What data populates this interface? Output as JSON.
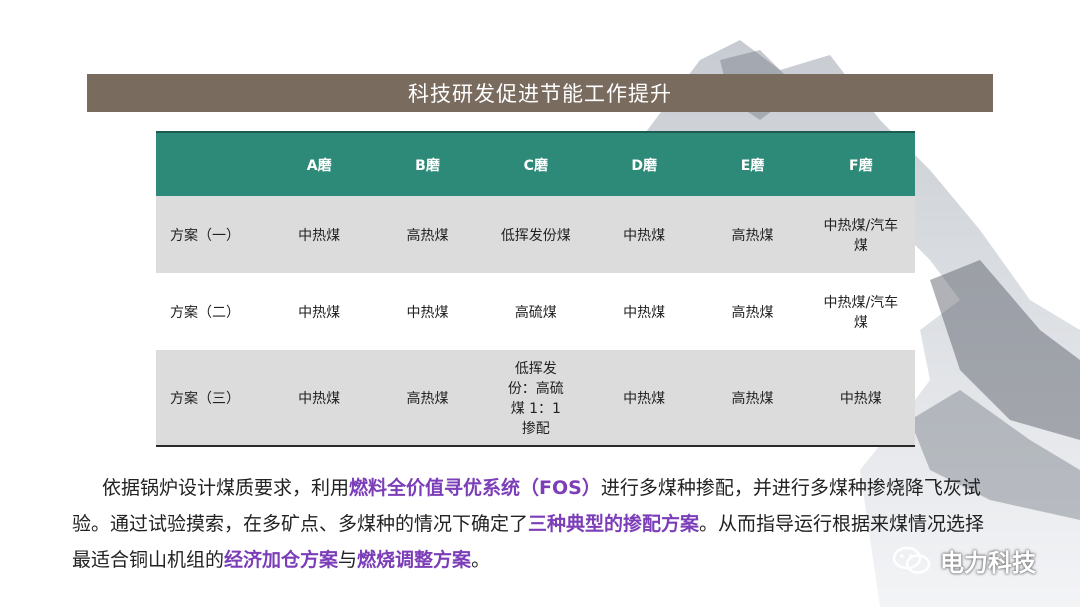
{
  "title": "科技研发促进节能工作提升",
  "table": {
    "headers": [
      "",
      "A磨",
      "B磨",
      "C磨",
      "D磨",
      "E磨",
      "F磨"
    ],
    "rows": [
      [
        "方案（一）",
        "中热煤",
        "高热煤",
        "低挥发份煤",
        "中热煤",
        "高热煤",
        "中热煤/汽车煤"
      ],
      [
        "方案（二）",
        "中热煤",
        "中热煤",
        "高硫煤",
        "中热煤",
        "高热煤",
        "中热煤/汽车煤"
      ],
      [
        "方案（三）",
        "中热煤",
        "高热煤",
        "低挥发份：高硫煤 1：1 掺配",
        "中热煤",
        "高热煤",
        "中热煤"
      ]
    ]
  },
  "paragraph": {
    "t1": "依据锅炉设计煤质要求，利用",
    "h1": "燃料全价值寻优系统（FOS）",
    "t2": "进行多煤种掺配，并进行多煤种掺烧降飞灰试验。通过试验摸索，在多矿点、多煤种的情况下确定了",
    "h2": "三种典型的掺配方案",
    "t3": "。从而指导运行根据来煤情况选择最适合铜山机组的",
    "h3": "经济加仓方案",
    "t4": "与",
    "h4": "燃烧调整方案",
    "t5": "。"
  },
  "watermark": {
    "text": "电力科技",
    "icon": "wechat-icon"
  },
  "colors": {
    "title_bar": "#7a6b5f",
    "header": "#2d8a79",
    "highlight": "#7b3db8"
  }
}
